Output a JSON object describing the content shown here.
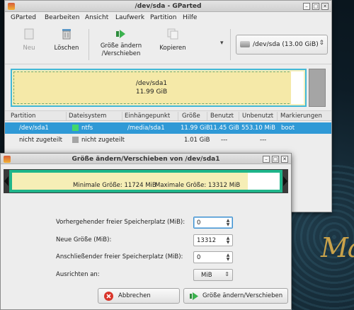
{
  "colors": {
    "selection": "#2f99d6",
    "ntfs": "#42d86b",
    "unallocated": "#a5a5a5",
    "partition_fill": "#f5e9a8",
    "resize_frame": "#1fb58a"
  },
  "main_window": {
    "title": "/dev/sda - GParted",
    "menu": [
      "GParted",
      "Bearbeiten",
      "Ansicht",
      "Laufwerk",
      "Partition",
      "Hilfe"
    ],
    "toolbar": {
      "new": "Neu",
      "delete": "Löschen",
      "resize_line1": "Größe ändern",
      "resize_line2": "/Verschieben",
      "copy": "Kopieren"
    },
    "device": "/dev/sda   (13.00 GiB)",
    "graphic": {
      "partition_name": "/dev/sda1",
      "partition_size": "11.99 GiB"
    },
    "table": {
      "headers": [
        "Partition",
        "Dateisystem",
        "Einhängepunkt",
        "Größe",
        "Benutzt",
        "Unbenutzt",
        "Markierungen"
      ],
      "rows": [
        {
          "partition": "/dev/sda1",
          "filesystem": "ntfs",
          "mount": "/media/sda1",
          "size": "11.99 GiB",
          "used": "11.45 GiB",
          "unused": "553.10 MiB",
          "flags": "boot"
        },
        {
          "partition": "nicht zugeteilt",
          "filesystem": "nicht zugeteilt",
          "mount": "",
          "size": "1.01 GiB",
          "used": "---",
          "unused": "---",
          "flags": ""
        }
      ]
    }
  },
  "dialog": {
    "title": "Größe ändern/Verschieben von /dev/sda1",
    "used_fraction": 0.88,
    "min_size": "Minimale Größe: 11724 MiB",
    "max_size": "Maximale Größe: 13312 MiB",
    "fields": {
      "free_before_label": "Vorhergehender freier Speicherplatz (MiB):",
      "free_before_value": "0",
      "new_size_label": "Neue Größe (MiB):",
      "new_size_value": "13312",
      "free_after_label": "Anschließender freier Speicherplatz (MiB):",
      "free_after_value": "0",
      "align_label": "Ausrichten an:",
      "align_value": "MiB"
    },
    "buttons": {
      "cancel": "Abbrechen",
      "resize": "Größe ändern/Verschieben"
    }
  }
}
